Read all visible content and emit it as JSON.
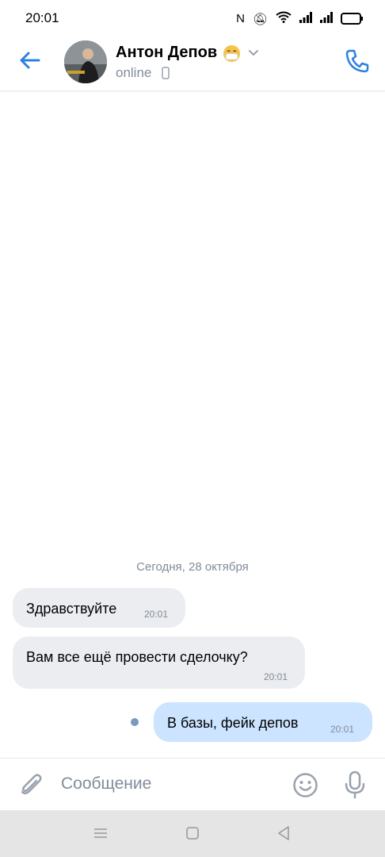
{
  "status_bar": {
    "time": "20:01"
  },
  "header": {
    "contact_name": "Антон Депов",
    "contact_status": "online"
  },
  "chat": {
    "date_divider": "Сегодня, 28 октября",
    "messages": [
      {
        "direction": "incoming",
        "text": "Здравствуйте",
        "time": "20:01"
      },
      {
        "direction": "incoming",
        "text": "Вам все ещё провести сделочку?",
        "time": "20:01"
      },
      {
        "direction": "outgoing",
        "text": "В базы, фейк депов",
        "time": "20:01"
      }
    ]
  },
  "composer": {
    "placeholder": "Сообщение"
  },
  "colors": {
    "accent": "#2d81e0",
    "incoming_bubble": "#ebedf0",
    "outgoing_bubble": "#cce4ff",
    "secondary_text": "#818c99"
  }
}
